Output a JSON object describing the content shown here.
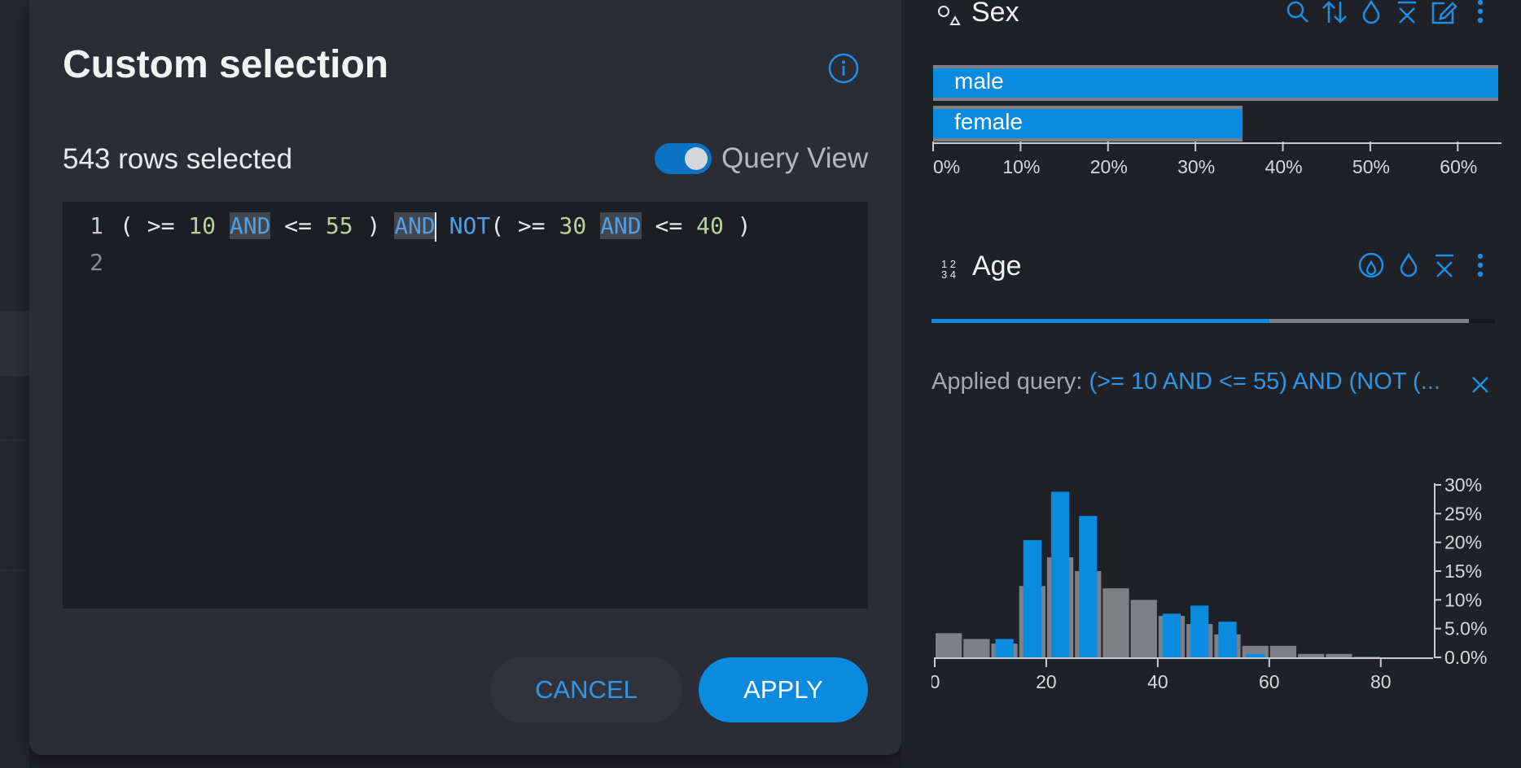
{
  "dialog": {
    "title": "Custom selection",
    "rows_selected": "543 rows selected",
    "toggle_label": "Query View",
    "toggle_on": true,
    "cancel_label": "CANCEL",
    "apply_label": "APPLY",
    "editor_lines": [
      {
        "number": "1",
        "tokens": [
          {
            "t": "( ",
            "k": "p"
          },
          {
            "t": ">= ",
            "k": "op"
          },
          {
            "t": "10",
            "k": "num"
          },
          {
            "t": " ",
            "k": "p"
          },
          {
            "t": "AND",
            "k": "kw",
            "hl": true
          },
          {
            "t": " <= ",
            "k": "op"
          },
          {
            "t": "55",
            "k": "num"
          },
          {
            "t": " ) ",
            "k": "p"
          },
          {
            "t": "AND",
            "k": "kw",
            "hl": true
          },
          {
            "t": "|",
            "k": "caret"
          },
          {
            "t": " ",
            "k": "p"
          },
          {
            "t": "NOT",
            "k": "kw"
          },
          {
            "t": "( ",
            "k": "p"
          },
          {
            "t": ">= ",
            "k": "op"
          },
          {
            "t": "30",
            "k": "num"
          },
          {
            "t": " ",
            "k": "p"
          },
          {
            "t": "AND",
            "k": "kw",
            "hl": true
          },
          {
            "t": " <= ",
            "k": "op"
          },
          {
            "t": "40",
            "k": "num"
          },
          {
            "t": " )",
            "k": "p"
          }
        ]
      },
      {
        "number": "2",
        "tokens": []
      }
    ]
  },
  "sex_panel": {
    "title": "Sex",
    "icons": [
      "search-icon",
      "sort-icon",
      "drop-icon",
      "x-bar-icon",
      "edit-icon",
      "more-icon"
    ],
    "bars": [
      {
        "label": "male",
        "value": 64.6
      },
      {
        "label": "female",
        "value": 35.4
      }
    ],
    "ticks": [
      "0%",
      "10%",
      "20%",
      "30%",
      "40%",
      "50%",
      "60%"
    ],
    "xlim": [
      0,
      65
    ]
  },
  "age_panel": {
    "title": "Age",
    "icons": [
      "filter-drop-icon",
      "drop-icon",
      "x-bar-icon",
      "more-icon"
    ],
    "progress": 0.6,
    "applied_label": "Applied query:",
    "applied_query": "(>= 10 AND <= 55) AND (NOT (...",
    "colors": {
      "selected": "#0a8be0",
      "total": "#7e8088"
    }
  },
  "chart_data": {
    "type": "bar",
    "title": "",
    "xlabel": "",
    "ylabel": "",
    "x_ticks": [
      "0",
      "20",
      "40",
      "60",
      "80"
    ],
    "y_ticks": [
      "0.0%",
      "5.0%",
      "10%",
      "15%",
      "20%",
      "25%",
      "30%"
    ],
    "xlim": [
      0,
      85
    ],
    "ylim": [
      0,
      30
    ],
    "bin_width": 5,
    "series": [
      {
        "name": "total",
        "x": [
          0,
          5,
          10,
          15,
          20,
          25,
          30,
          35,
          40,
          45,
          50,
          55,
          60,
          65,
          70,
          75
        ],
        "values": [
          4.2,
          3.2,
          2.4,
          12.4,
          17.4,
          15.0,
          12.0,
          10.0,
          7.2,
          5.8,
          4.0,
          2.0,
          2.0,
          0.6,
          0.6,
          0.1
        ]
      },
      {
        "name": "selected",
        "x": [
          10,
          15,
          20,
          25,
          40,
          45,
          50,
          55
        ],
        "values": [
          3.2,
          20.4,
          28.8,
          24.6,
          7.6,
          9.0,
          6.2,
          0.6
        ]
      }
    ]
  }
}
